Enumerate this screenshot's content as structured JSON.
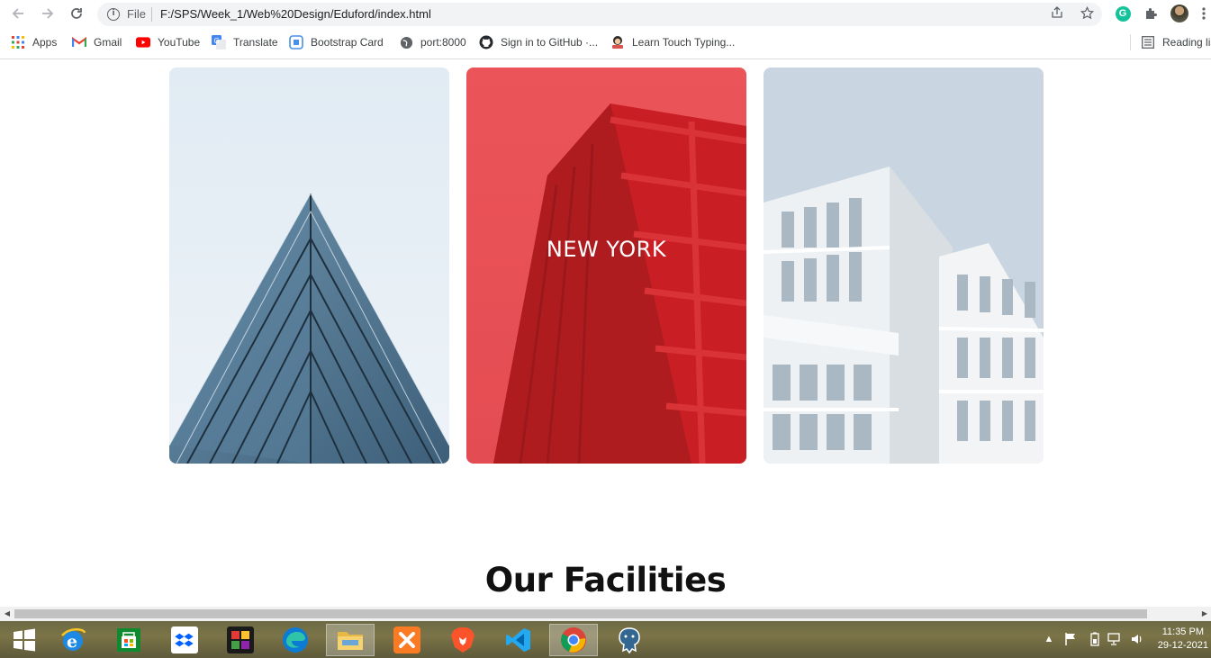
{
  "browser": {
    "omnibox": {
      "scheme_label": "File",
      "url": "F:/SPS/Week_1/Web%20Design/Eduford/index.html"
    },
    "bookmarks": [
      {
        "label": "Apps",
        "icon": "apps-grid-icon"
      },
      {
        "label": "Gmail",
        "icon": "gmail-icon"
      },
      {
        "label": "YouTube",
        "icon": "youtube-icon"
      },
      {
        "label": "Translate",
        "icon": "translate-icon"
      },
      {
        "label": "Bootstrap Card",
        "icon": "bootstrap-icon"
      },
      {
        "label": "port:8000",
        "icon": "globe-icon"
      },
      {
        "label": "Sign in to GitHub ·...",
        "icon": "github-icon"
      },
      {
        "label": "Learn Touch Typing...",
        "icon": "typing-icon"
      }
    ],
    "reading_list": "Reading list"
  },
  "page": {
    "cards": [
      {
        "label": "",
        "image": "glass-pyramid-building"
      },
      {
        "label": "NEW YORK",
        "image": "red-tower-building"
      },
      {
        "label": "",
        "image": "white-modern-building"
      }
    ],
    "section_title": "Our Facilities"
  },
  "taskbar": {
    "apps": [
      "start",
      "internet-explorer",
      "store",
      "dropbox",
      "puzzle-app",
      "edge",
      "file-explorer",
      "xampp",
      "brave",
      "vscode",
      "chrome",
      "postgresql"
    ],
    "active_app": "chrome",
    "clock": {
      "time": "11:35 PM",
      "date": "29-12-2021"
    }
  },
  "colors": {
    "accent_red": "#e03a3e",
    "card_sky": "#dfe9f1"
  }
}
